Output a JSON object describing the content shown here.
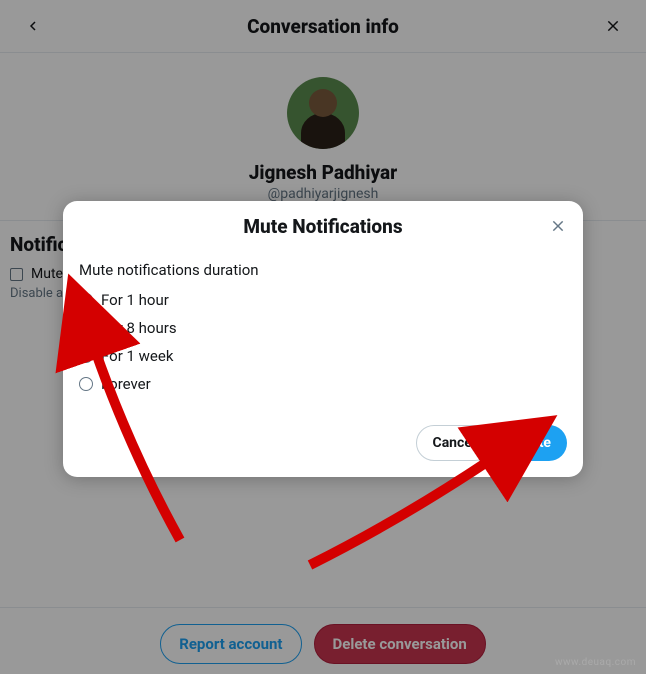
{
  "topbar": {
    "title": "Conversation info"
  },
  "profile": {
    "name": "Jignesh Padhiyar",
    "handle": "@padhiyarjignesh"
  },
  "notifications": {
    "heading": "Notifications",
    "mute_label": "Mute",
    "disable_prefix": "Disable all"
  },
  "footer": {
    "report": "Report account",
    "delete": "Delete conversation"
  },
  "modal": {
    "title": "Mute Notifications",
    "subtitle": "Mute notifications duration",
    "options": {
      "0": {
        "label": "For 1 hour"
      },
      "1": {
        "label": "For 8 hours"
      },
      "2": {
        "label": "For 1 week"
      },
      "3": {
        "label": "Forever"
      }
    },
    "selected_index": 1,
    "cancel": "Cancel",
    "confirm": "Mute"
  },
  "watermark": "www.deuaq.com"
}
